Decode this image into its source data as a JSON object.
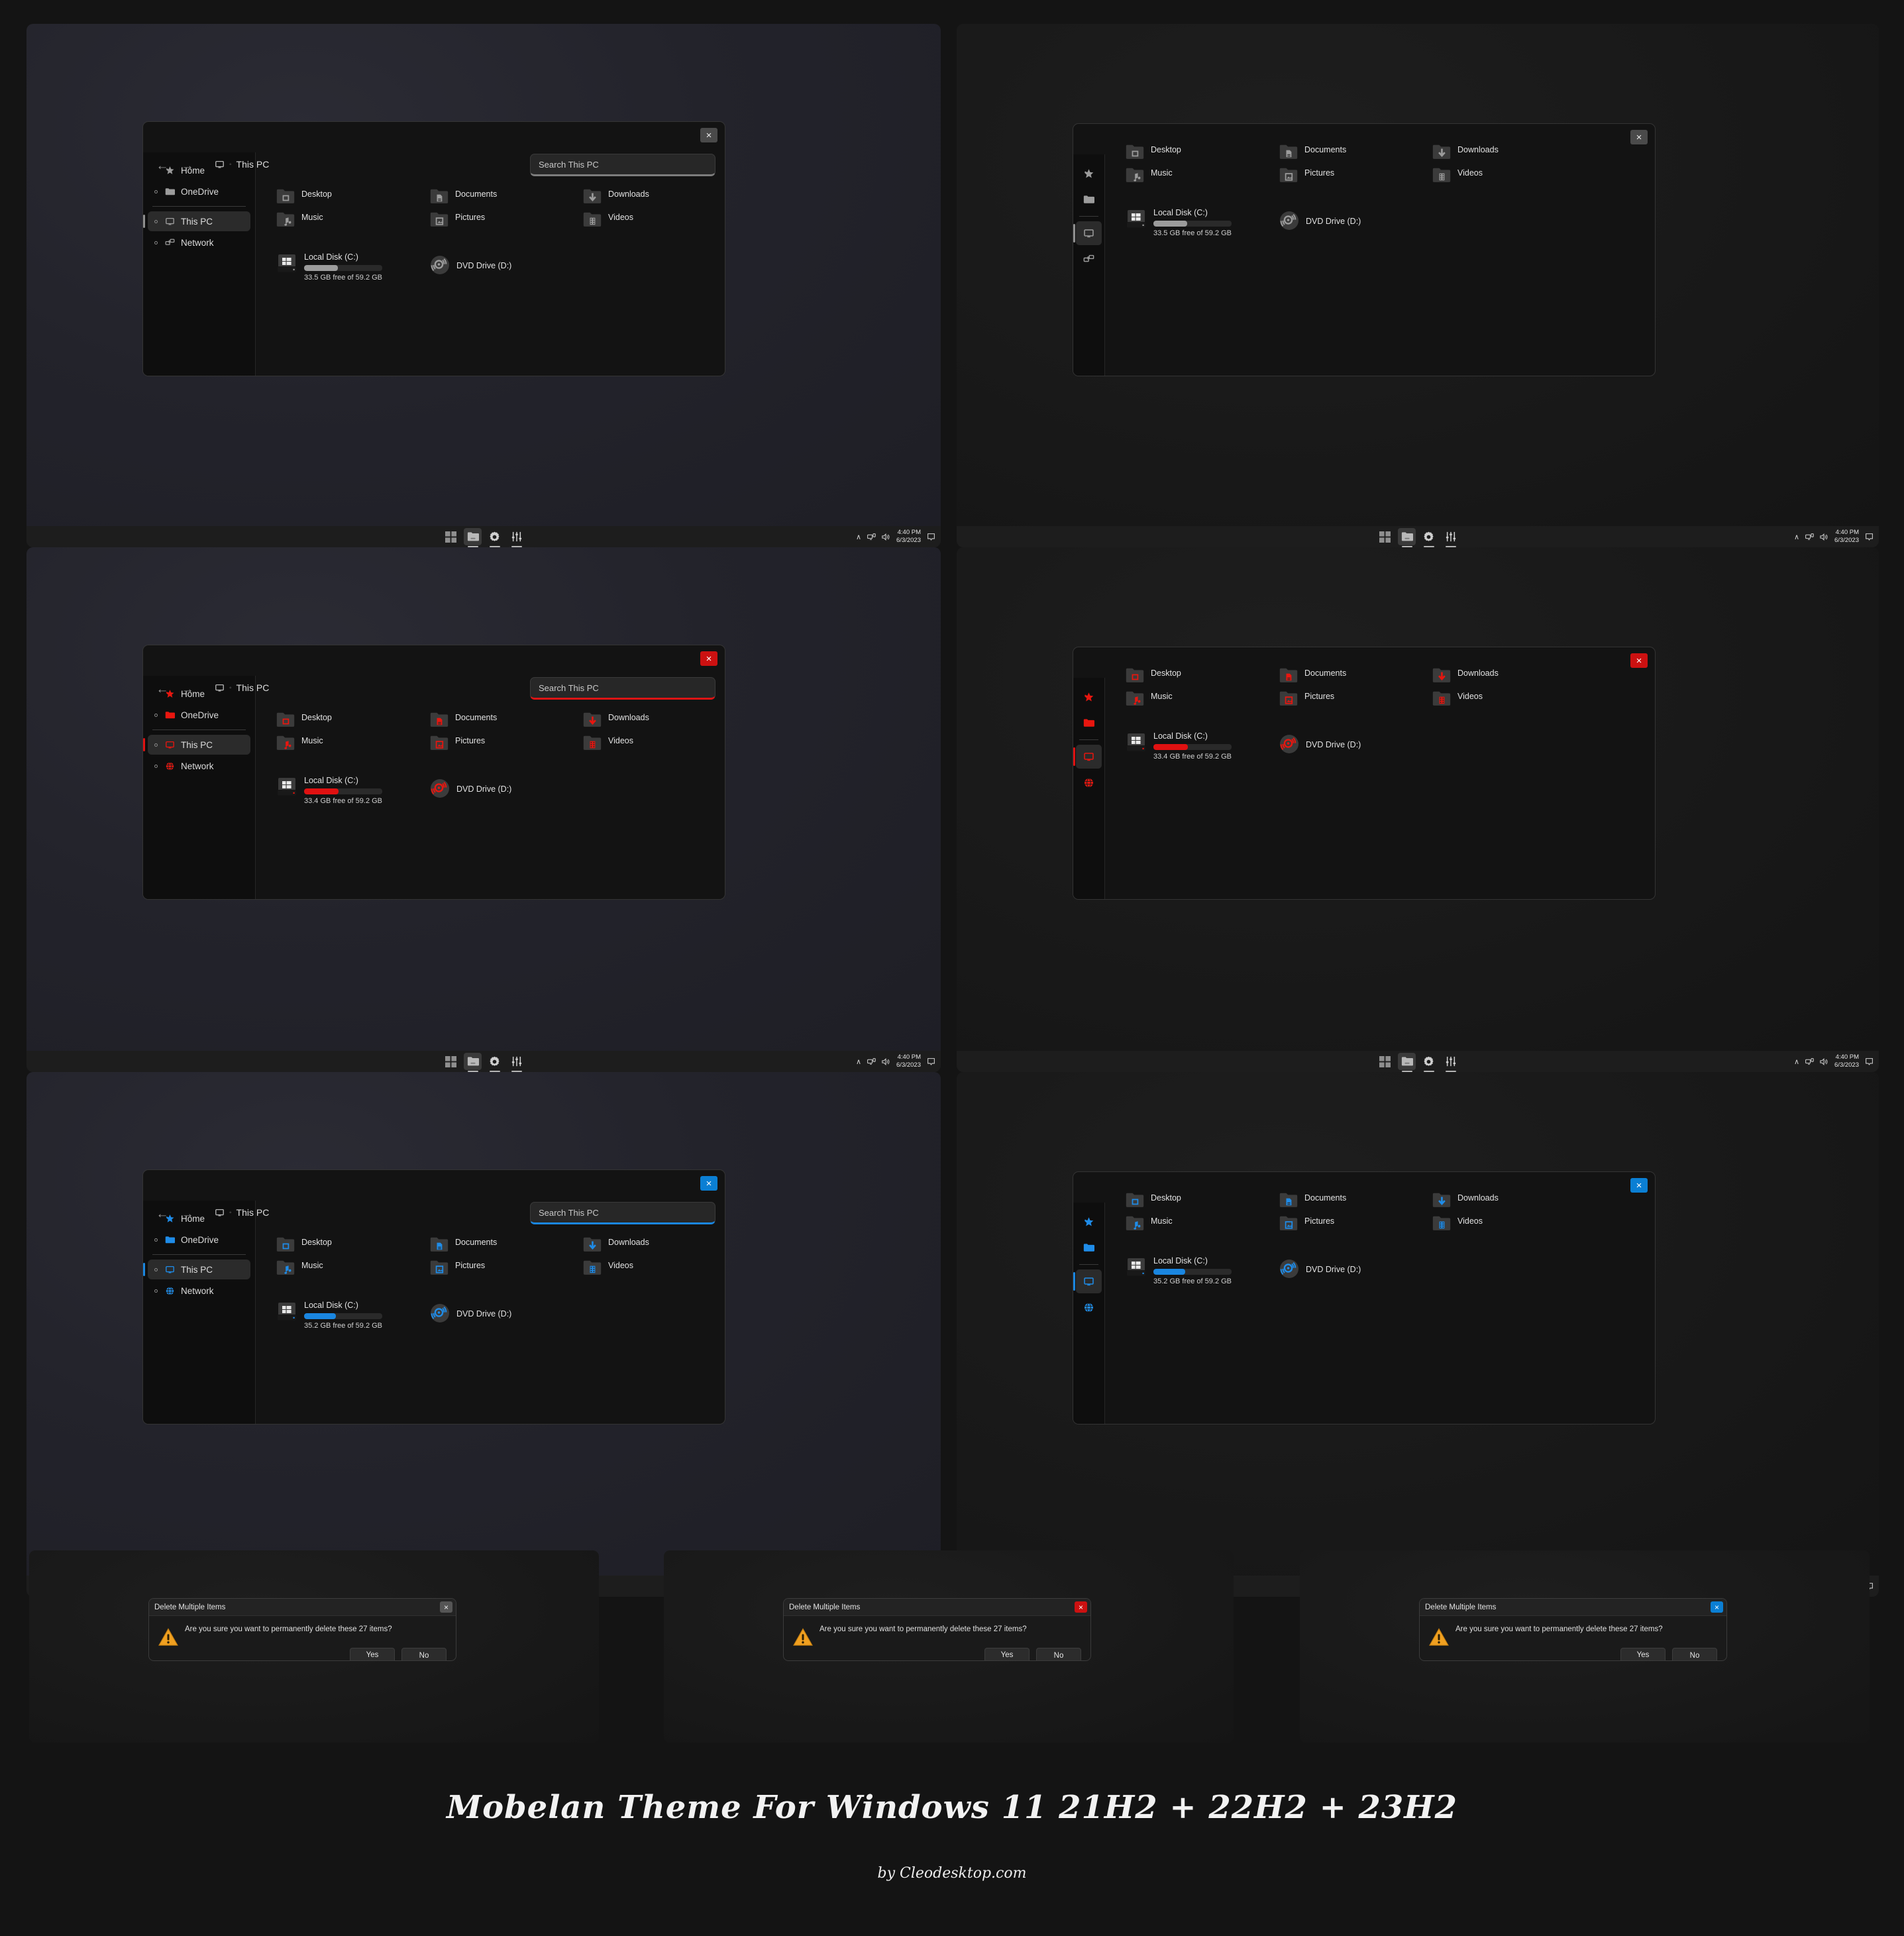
{
  "footer": {
    "title": "Mobelan Theme For Windows 11 21H2 + 22H2 + 23H2",
    "credit": "by Cleodesktop.com"
  },
  "colors": {
    "accent_gray": "#9c9c9c",
    "accent_red": "#e01111",
    "accent_blue": "#1a86e0",
    "window_bg": "#131313",
    "sidebar_bg": "#0e0e0e",
    "taskbar_bg": "#1d1d1d",
    "desktop_bg": "#26262e"
  },
  "explorer": {
    "breadcrumb": "This PC",
    "search_placeholder": "Search This PC",
    "close_label": "×",
    "back_label": "←",
    "forward_label": "→",
    "sidebar": [
      {
        "label": "Home",
        "icon": "star-icon",
        "selected": false,
        "has_chevron": false
      },
      {
        "label": "OneDrive",
        "icon": "onedrive-folder-icon",
        "selected": false,
        "has_chevron": true
      },
      {
        "label": "This PC",
        "icon": "this-pc-monitor-icon",
        "selected": true,
        "has_chevron": true
      },
      {
        "label": "Network",
        "icon": "network-icon",
        "selected": false,
        "has_chevron": true
      }
    ],
    "folders": [
      {
        "label": "Desktop",
        "icon": "desktop-folder-icon"
      },
      {
        "label": "Documents",
        "icon": "documents-folder-icon"
      },
      {
        "label": "Downloads",
        "icon": "downloads-folder-icon"
      },
      {
        "label": "Music",
        "icon": "music-folder-icon"
      },
      {
        "label": "Pictures",
        "icon": "pictures-folder-icon"
      },
      {
        "label": "Videos",
        "icon": "videos-folder-icon"
      }
    ],
    "drives": {
      "local_disk_name": "Local Disk (C:)",
      "dvd_name": "DVD Drive (D:)",
      "capacity_total": "59.2 GB",
      "free_gray": "33.5 GB free of 59.2 GB",
      "free_red": "33.4 GB free of 59.2 GB",
      "free_blue": "35.2 GB free of 59.2 GB",
      "used_percent_gray": 43,
      "used_percent_red": 44,
      "used_percent_blue": 41
    }
  },
  "taskbar": {
    "buttons": [
      {
        "name": "start-button",
        "icon": "windows-start-icon",
        "active": false,
        "indicator": false
      },
      {
        "name": "file-explorer-button",
        "icon": "folder-icon",
        "active": true,
        "indicator": true
      },
      {
        "name": "settings-button",
        "icon": "gear-icon",
        "active": false,
        "indicator": true
      },
      {
        "name": "equalizer-button",
        "icon": "equalizer-icon",
        "active": false,
        "indicator": true
      }
    ],
    "tray": [
      {
        "name": "show-hidden-icons",
        "icon": "chevron-up-icon",
        "glyph": "∧"
      },
      {
        "name": "network-tray-icon",
        "icon": "network-icon",
        "glyph": ""
      },
      {
        "name": "volume-tray-icon",
        "icon": "speaker-icon",
        "glyph": ""
      }
    ],
    "clock_time": "4:40 PM",
    "clock_date": "6/3/2023",
    "notification_icon": "notification-bell-icon"
  },
  "dialog": {
    "title": "Delete Multiple Items",
    "message": "Are you sure you want to permanently delete these 27 items?",
    "yes_label": "Yes",
    "no_label": "No",
    "close_label": "×",
    "warning_icon": "warning-triangle-icon"
  },
  "variants": [
    {
      "id": "gray",
      "row": 0,
      "col": 0,
      "sidebar": "expanded",
      "accent": "#9c9c9c"
    },
    {
      "id": "gray",
      "row": 0,
      "col": 1,
      "sidebar": "collapsed",
      "accent": "#9c9c9c"
    },
    {
      "id": "red",
      "row": 1,
      "col": 0,
      "sidebar": "expanded",
      "accent": "#e01111"
    },
    {
      "id": "red",
      "row": 1,
      "col": 1,
      "sidebar": "collapsed",
      "accent": "#e01111"
    },
    {
      "id": "blue",
      "row": 2,
      "col": 0,
      "sidebar": "expanded",
      "accent": "#1a86e0"
    },
    {
      "id": "blue",
      "row": 2,
      "col": 1,
      "sidebar": "collapsed",
      "accent": "#1a86e0"
    }
  ]
}
